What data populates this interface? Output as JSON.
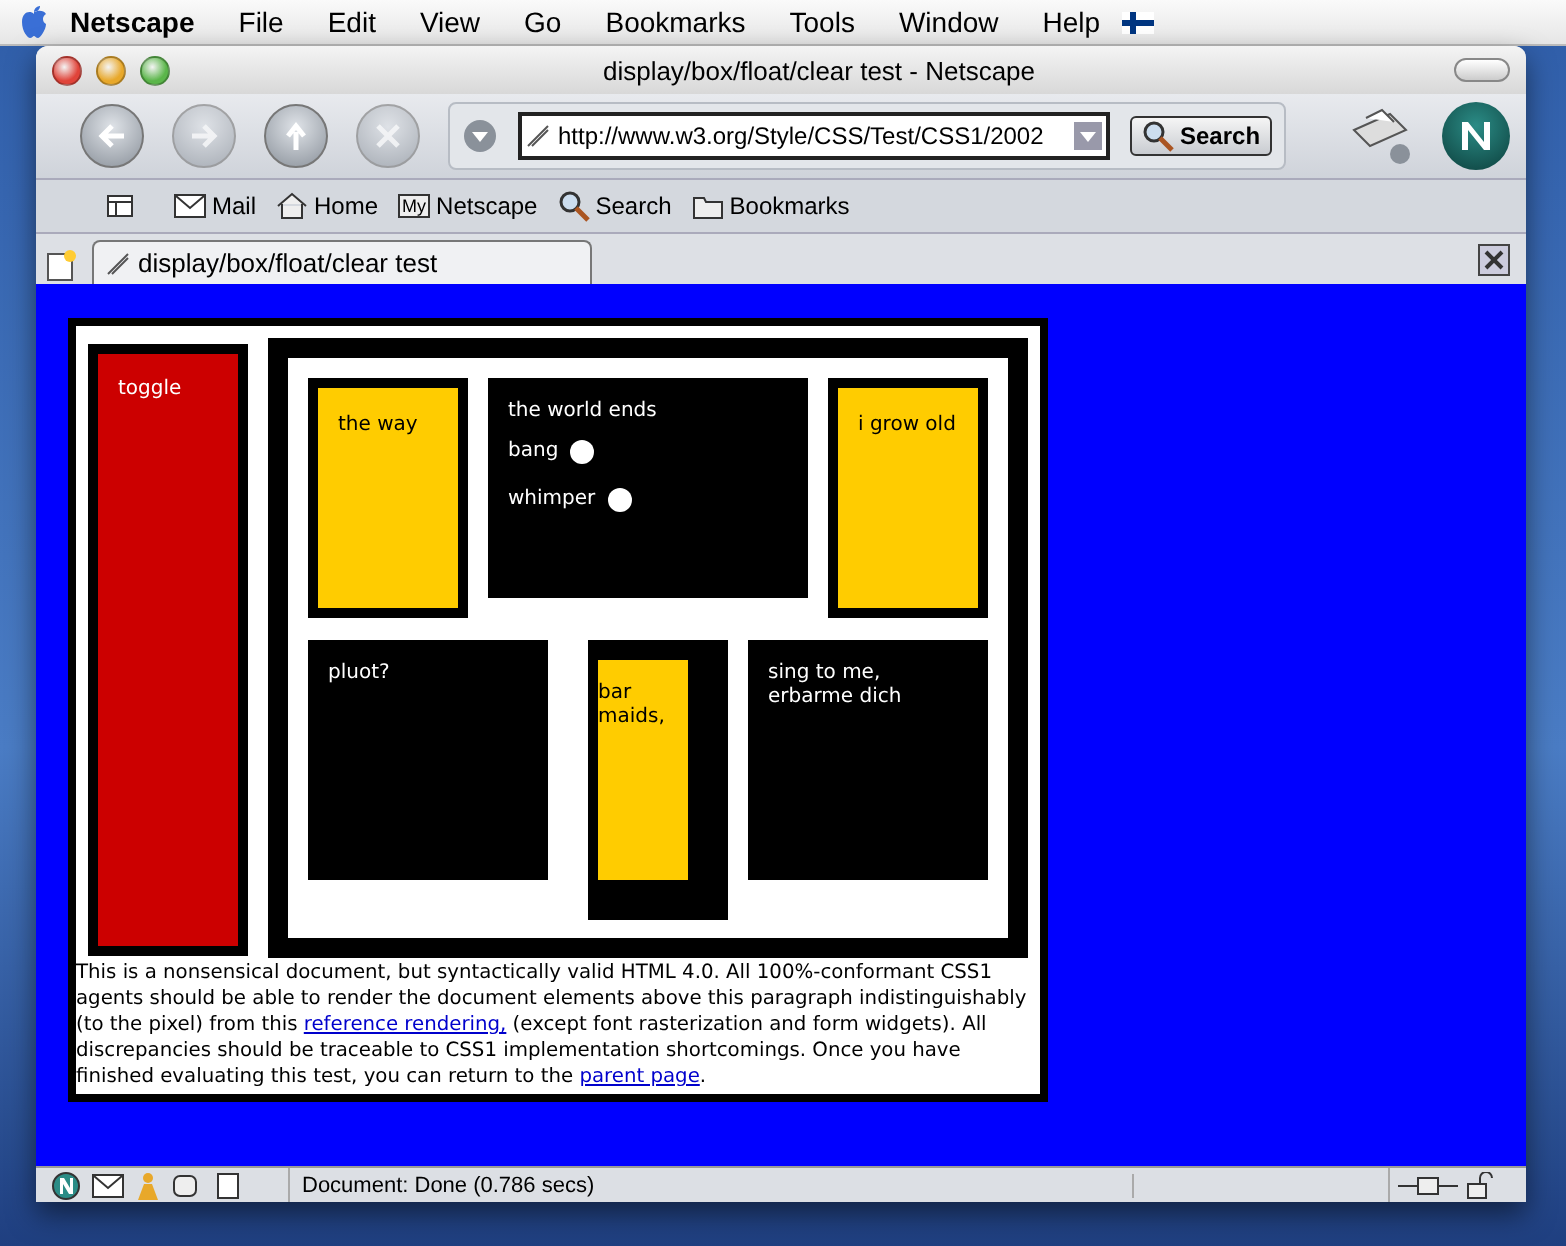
{
  "menu_bar": {
    "app": "Netscape",
    "items": [
      "File",
      "Edit",
      "View",
      "Go",
      "Bookmarks",
      "Tools",
      "Window",
      "Help"
    ]
  },
  "window": {
    "title": "display/box/float/clear test - Netscape"
  },
  "toolbar": {
    "url": "http://www.w3.org/Style/CSS/Test/CSS1/2002",
    "search_button": "Search"
  },
  "personal_toolbar": [
    {
      "kind": "mail",
      "label": "Mail"
    },
    {
      "kind": "home",
      "label": "Home"
    },
    {
      "kind": "my",
      "badge": "My",
      "label": "Netscape"
    },
    {
      "kind": "search",
      "label": "Search"
    },
    {
      "kind": "folder",
      "label": "Bookmarks"
    }
  ],
  "tab": {
    "title": "display/box/float/clear test"
  },
  "document": {
    "toggle": "toggle",
    "the_way": "the way",
    "world": {
      "heading": "the world ends",
      "options": [
        {
          "label": "bang",
          "checked": false
        },
        {
          "label": "whimper",
          "checked": false
        }
      ]
    },
    "grow_old": "i grow old",
    "pluot": "pluot?",
    "bar": [
      "bar",
      "maids,"
    ],
    "sing": [
      "sing to me,",
      "erbarme dich"
    ],
    "paragraph": [
      {
        "kind": "text",
        "text": "This is a nonsensical document, but syntactically valid HTML 4.0. All 100%-conformant CSS1 agents should be able to render the document elements above this paragraph indistinguishably (to the pixel) from this "
      },
      {
        "kind": "link",
        "text": "reference rendering,"
      },
      {
        "kind": "text",
        "text": " (except font rasterization and form widgets). All discrepancies should be traceable to CSS1 implementation shortcomings. Once you have finished evaluating this test, you can return to the "
      },
      {
        "kind": "link",
        "text": "parent page"
      },
      {
        "kind": "text",
        "text": "."
      }
    ]
  },
  "status_bar": {
    "text": "Document: Done (0.786 secs)"
  }
}
